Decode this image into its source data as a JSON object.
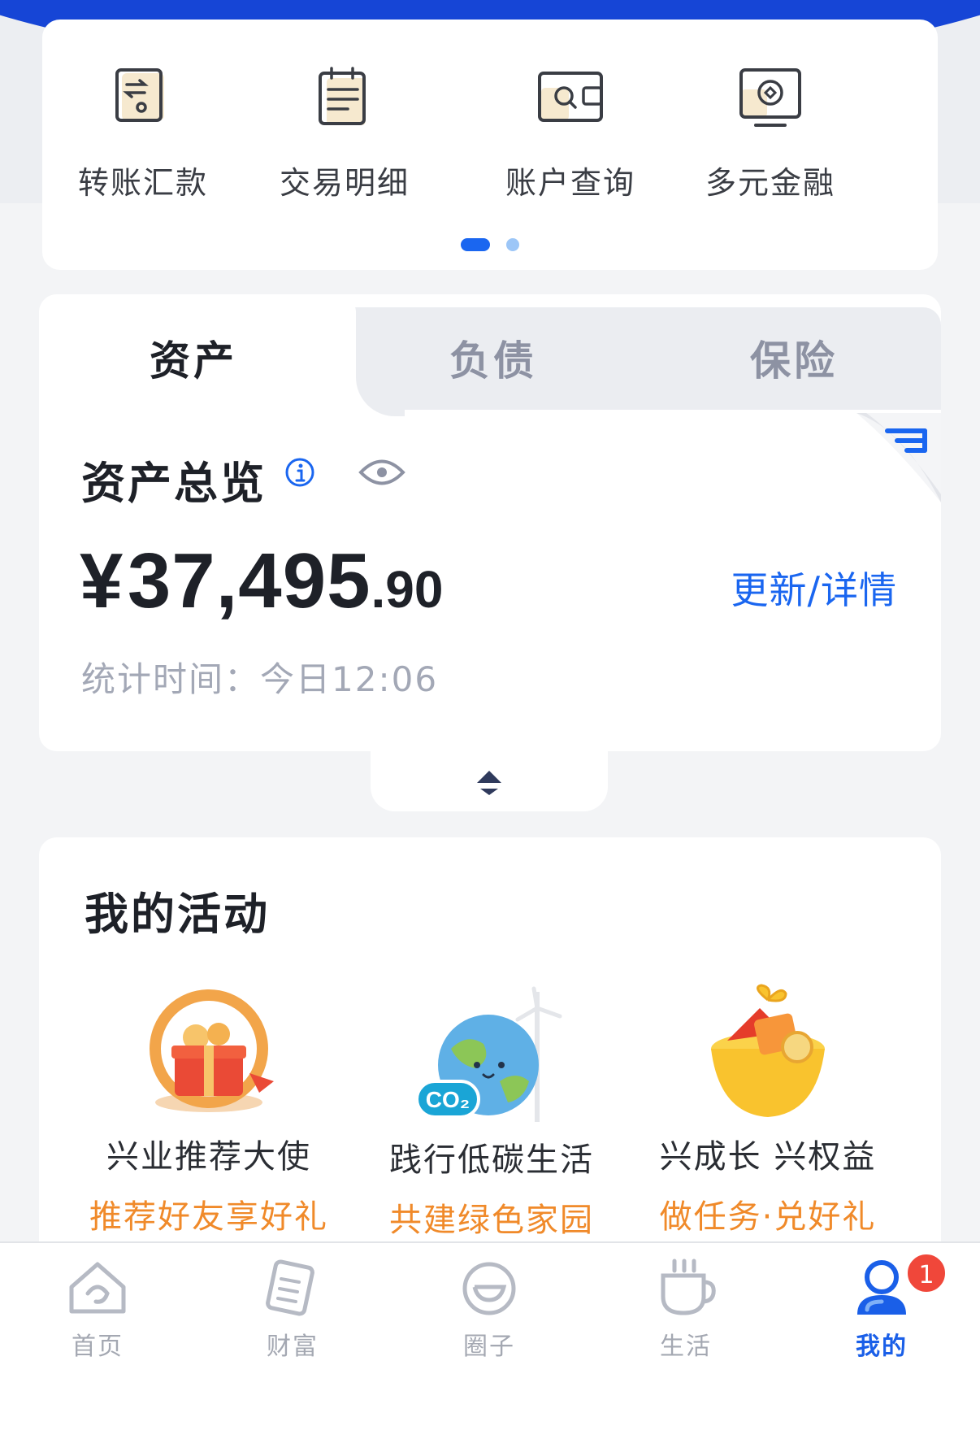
{
  "quick_services": [
    {
      "label": "转账汇款",
      "icon": "transfer-icon"
    },
    {
      "label": "交易明细",
      "icon": "transaction-list-icon"
    },
    {
      "label": "账户查询",
      "icon": "account-query-icon"
    },
    {
      "label": "多元金融",
      "icon": "diversified-finance-icon"
    }
  ],
  "pager": {
    "pages": 2,
    "current": 1
  },
  "asset_tabs": [
    "资产",
    "负债",
    "保险"
  ],
  "overview": {
    "title": "资产总览",
    "currency": "¥",
    "amount_int": "37,495",
    "amount_dec": ".90",
    "update_link": "更新/详情",
    "stat_time": "统计时间：今日12:06"
  },
  "activities": {
    "title": "我的活动",
    "items": [
      {
        "name": "兴业推荐大使",
        "sub": "推荐好友享好礼"
      },
      {
        "name": "践行低碳生活",
        "sub": "共建绿色家园"
      },
      {
        "name": "兴成长 兴权益",
        "sub": "做任务·兑好礼"
      }
    ]
  },
  "bottom_nav": [
    {
      "label": "首页",
      "icon": "home-icon"
    },
    {
      "label": "财富",
      "icon": "wealth-icon"
    },
    {
      "label": "圈子",
      "icon": "circle-icon"
    },
    {
      "label": "生活",
      "icon": "life-cup-icon"
    },
    {
      "label": "我的",
      "icon": "profile-icon",
      "active": true
    }
  ],
  "notification_badge": "1",
  "colors": {
    "brand_blue": "#1645d6",
    "accent": "#1a66f0",
    "orange": "#f08a2a",
    "badge": "#f0473a"
  }
}
